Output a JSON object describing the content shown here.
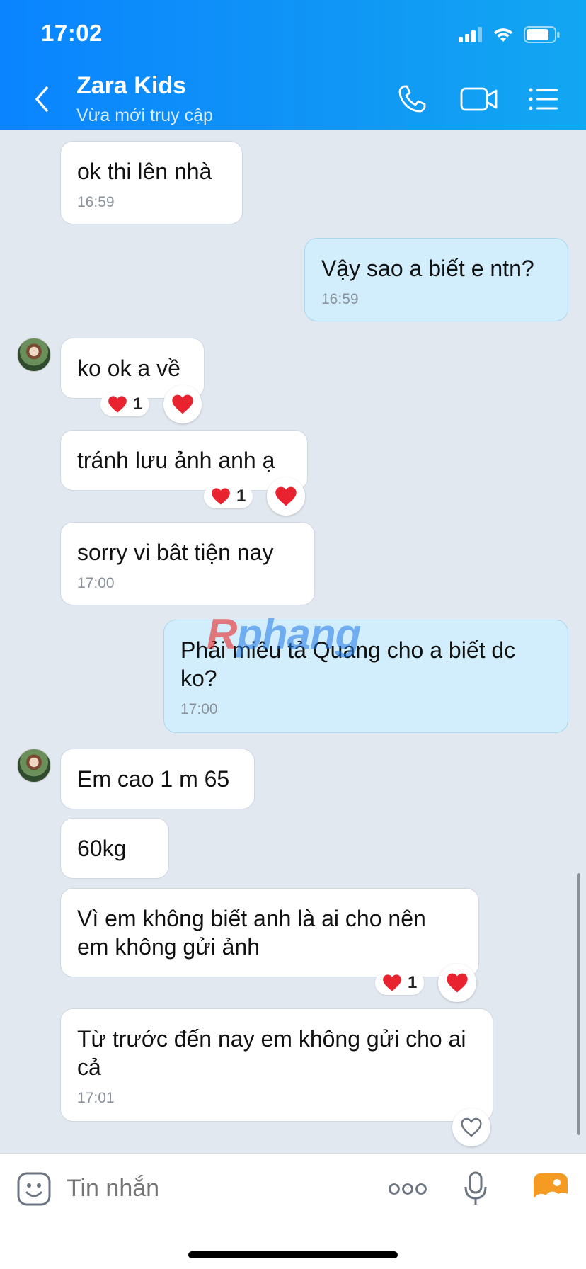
{
  "status_bar": {
    "time": "17:02"
  },
  "header": {
    "title": "Zara Kids",
    "subtitle": "Vừa mới truy cập"
  },
  "watermark": {
    "first": "R",
    "rest": "phang"
  },
  "messages": [
    {
      "id": "m1",
      "sender": "them",
      "text": "ok thi lên nhà",
      "time": "16:59"
    },
    {
      "id": "m2",
      "sender": "me",
      "text": "Vậy sao a biết e ntn?",
      "time": "16:59"
    },
    {
      "id": "m3",
      "sender": "them",
      "text": "ko ok a về",
      "reaction": {
        "emoji": "heart",
        "count": "1"
      }
    },
    {
      "id": "m4",
      "sender": "them",
      "text": "tránh lưu ảnh anh ạ",
      "reaction": {
        "emoji": "heart",
        "count": "1"
      }
    },
    {
      "id": "m5",
      "sender": "them",
      "text": "sorry vi bât tiện nay",
      "time": "17:00"
    },
    {
      "id": "m6",
      "sender": "me",
      "text": "Phải miêu tả Quang cho a biết dc ko?",
      "time": "17:00"
    },
    {
      "id": "m7",
      "sender": "them",
      "text": "Em cao 1 m 65"
    },
    {
      "id": "m8",
      "sender": "them",
      "text": "60kg"
    },
    {
      "id": "m9",
      "sender": "them",
      "text": "Vì em không biết anh là ai cho nên em không gửi ảnh",
      "reaction": {
        "emoji": "heart",
        "count": "1"
      }
    },
    {
      "id": "m10",
      "sender": "them",
      "text": "Từ trước đến nay em không gửi cho ai cả",
      "time": "17:01"
    }
  ],
  "composer": {
    "placeholder": "Tin nhắn"
  },
  "colors": {
    "header_gradient_start": "#0a84ff",
    "header_gradient_end": "#12a7f2",
    "chat_background": "#e2e8f0",
    "my_bubble": "#d2eefc",
    "their_bubble": "#ffffff",
    "reaction_heart": "#e8232f"
  },
  "icons": [
    "back-icon",
    "phone-icon",
    "video-icon",
    "list-icon",
    "sticker-icon",
    "more-icon",
    "microphone-icon",
    "photo-icon",
    "heart-icon"
  ]
}
